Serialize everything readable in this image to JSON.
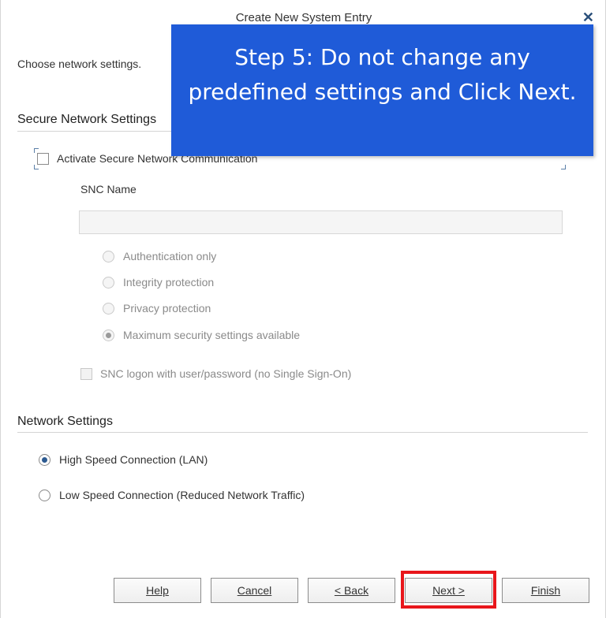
{
  "window": {
    "title": "Create New System Entry",
    "close_icon": "close-icon"
  },
  "subtitle": "Choose network settings.",
  "secure_network": {
    "header": "Secure Network Settings",
    "activate_label": "Activate Secure Network Communication",
    "activate_checked": false,
    "snc_name_label": "SNC Name",
    "snc_name_value": "",
    "options": [
      {
        "label": "Authentication only",
        "checked": false
      },
      {
        "label": "Integrity protection",
        "checked": false
      },
      {
        "label": "Privacy protection",
        "checked": false
      },
      {
        "label": "Maximum security settings available",
        "checked": true
      }
    ],
    "logon_label": "SNC logon with user/password (no Single Sign-On)",
    "logon_checked": false
  },
  "network": {
    "header": "Network Settings",
    "options": [
      {
        "label": "High Speed Connection (LAN)",
        "checked": true
      },
      {
        "label": "Low Speed Connection (Reduced Network Traffic)",
        "checked": false
      }
    ]
  },
  "buttons": {
    "help": "Help",
    "cancel": "Cancel",
    "back": "< Back",
    "next": "Next >",
    "finish": "Finish"
  },
  "callout": {
    "line1": "Step 5: Do not change any",
    "line2": "predefined settings and Click Next."
  },
  "colors": {
    "callout_bg": "#1f5bd8",
    "highlight_border": "#e8161b",
    "radio_selected": "#2c5a91"
  }
}
